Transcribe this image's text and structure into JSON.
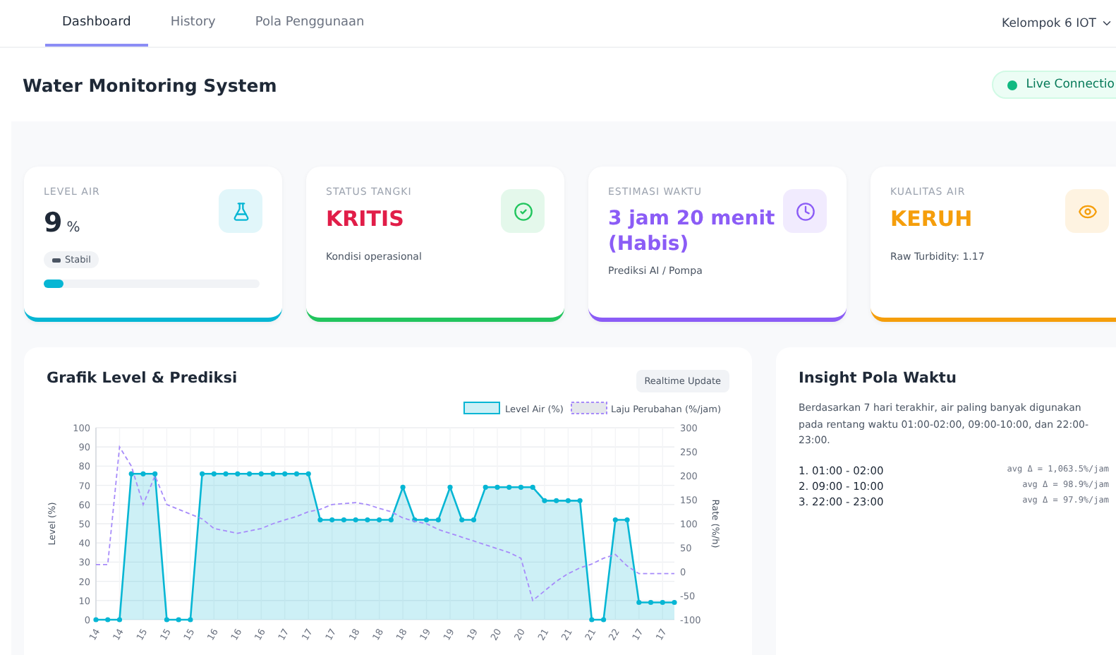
{
  "nav": {
    "tabs": [
      {
        "label": "Dashboard",
        "selected": true
      },
      {
        "label": "History",
        "selected": false
      },
      {
        "label": "Pola Penggunaan",
        "selected": false
      }
    ],
    "user": "Kelompok 6 IOT"
  },
  "header": {
    "title": "Water Monitoring System",
    "connection": {
      "label": "Live Connectio",
      "online": true
    }
  },
  "cards": [
    {
      "kind": "level",
      "label": "LEVEL AIR",
      "value": "9",
      "unit": "%",
      "badge": "Stabil",
      "level": 0.09,
      "color": "#06b6d4"
    },
    {
      "kind": "status",
      "label": "STATUS TANGKI",
      "value": "KRITIS",
      "note": "Kondisi operasional",
      "color": "#22c55e"
    },
    {
      "kind": "time",
      "label": "ESTIMASI WAKTU",
      "value": "3 jam 20 menit (Habis)",
      "note": "Prediksi AI / Pompa",
      "color": "#8b5cf6"
    },
    {
      "kind": "quality",
      "label": "KUALITAS AIR",
      "value": "KERUH",
      "note": "Raw Turbidity: 1.17",
      "color": "#f59e0b"
    }
  ],
  "chart_panel": {
    "title": "Grafik Level & Prediksi",
    "badge": "Realtime Update",
    "chart_data": {
      "type": "area",
      "grid": true,
      "ylabel": "Level (%)",
      "ylim": [
        0,
        100
      ],
      "yticks": [
        0,
        10,
        20,
        30,
        40,
        50,
        60,
        70,
        80,
        90,
        100
      ],
      "categories": [
        "14",
        null,
        "14",
        null,
        "15",
        null,
        "15",
        null,
        "15",
        null,
        "16",
        null,
        "16",
        null,
        "16",
        null,
        "17",
        null,
        "17",
        null,
        "17",
        null,
        "18",
        null,
        "18",
        null,
        "18",
        null,
        "19",
        null,
        "19",
        null,
        "19",
        null,
        "20",
        null,
        "20",
        null,
        "21",
        null,
        "21",
        null,
        "21",
        null,
        "22",
        null,
        "17",
        null,
        "17",
        null
      ],
      "series": [
        {
          "name": "Level Air (%)",
          "color": "#06b6d4",
          "values": [
            0,
            0,
            0,
            76,
            76,
            76,
            0,
            0,
            0,
            76,
            76,
            76,
            76,
            76,
            76,
            76,
            76,
            76,
            76,
            52,
            52,
            52,
            52,
            52,
            52,
            52,
            69,
            52,
            52,
            52,
            69,
            52,
            52,
            69,
            69,
            69,
            69,
            69,
            62,
            62,
            62,
            62,
            0,
            0,
            52,
            52,
            9,
            9,
            9,
            9
          ]
        }
      ]
    },
    "rate_overlay": {
      "chart_data": {
        "type": "line",
        "ylabel": "Rate (%/h)",
        "ylim": [
          -100,
          300
        ],
        "yticks": [
          -100,
          -50,
          0,
          50,
          100,
          150,
          200,
          250,
          300
        ],
        "series": [
          {
            "name": "Laju Perubahan (%/jam)",
            "color": "#a78bfa",
            "line_style": "dashed",
            "values": [
              15,
              15,
              260,
              220,
              140,
              200,
              140,
              130,
              120,
              110,
              90,
              85,
              80,
              85,
              90,
              100,
              108,
              115,
              125,
              130,
              140,
              142,
              144,
              140,
              132,
              125,
              112,
              105,
              100,
              88,
              80,
              72,
              64,
              56,
              48,
              40,
              28,
              -60,
              -40,
              -20,
              -4,
              8,
              16,
              28,
              36,
              12,
              -4,
              -4,
              -4,
              -4
            ]
          }
        ]
      }
    }
  },
  "insight": {
    "title": "Insight Pola Waktu",
    "text": "Berdasarkan 7 hari terakhir, air paling banyak digunakan pada rentang waktu 01:00-02:00, 09:00-10:00, dan 22:00-23:00.",
    "items": [
      {
        "label": "1. 01:00 - 02:00",
        "avg": "avg Δ = 1,063.5%/jam"
      },
      {
        "label": "2. 09:00 - 10:00",
        "avg": "avg Δ = 98.9%/jam"
      },
      {
        "label": "3. 22:00 - 23:00",
        "avg": "avg Δ = 97.9%/jam"
      }
    ]
  }
}
